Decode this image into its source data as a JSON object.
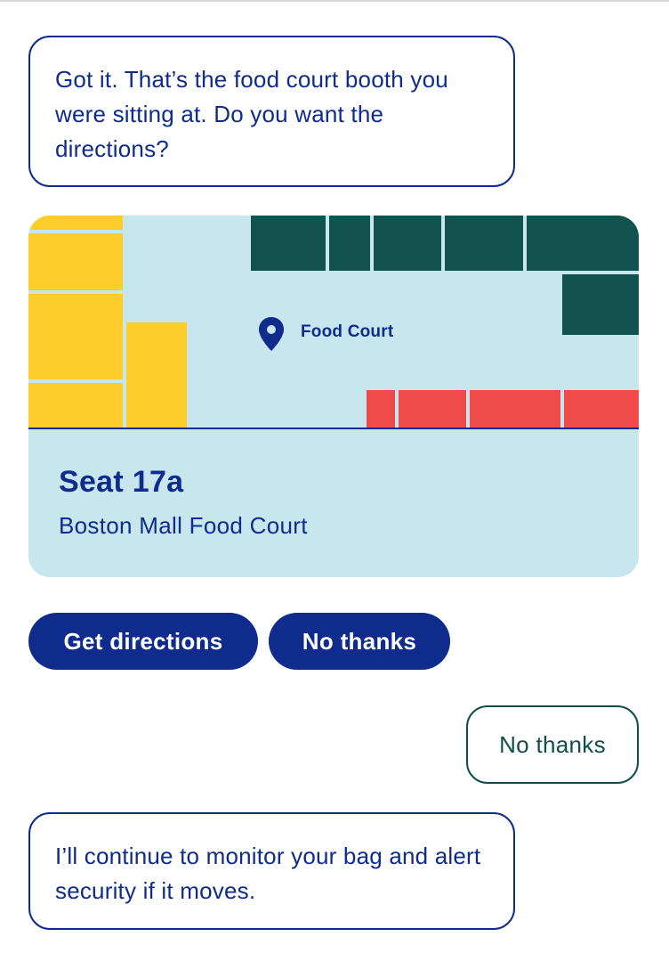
{
  "conversation": {
    "bot_message_1": "Got it. That’s the food court booth you were sitting at. Do you want the directions?",
    "location_card": {
      "map_label": "Food Court",
      "seat": "Seat 17a",
      "venue": "Boston Mall Food Court"
    },
    "quick_replies": {
      "get_directions": "Get directions",
      "no_thanks": "No thanks"
    },
    "user_message": "No thanks",
    "bot_message_2": "I’ll continue to monitor your bag and alert security if it moves."
  },
  "colors": {
    "primary_navy": "#0f2b8c",
    "map_background": "#c8e6ee",
    "store_yellow": "#fdcd2b",
    "store_teal": "#12524f",
    "store_red": "#ef4b4b",
    "user_bubble_border": "#0f4f4b"
  },
  "icons": {
    "map_pin": "map-pin-icon"
  }
}
